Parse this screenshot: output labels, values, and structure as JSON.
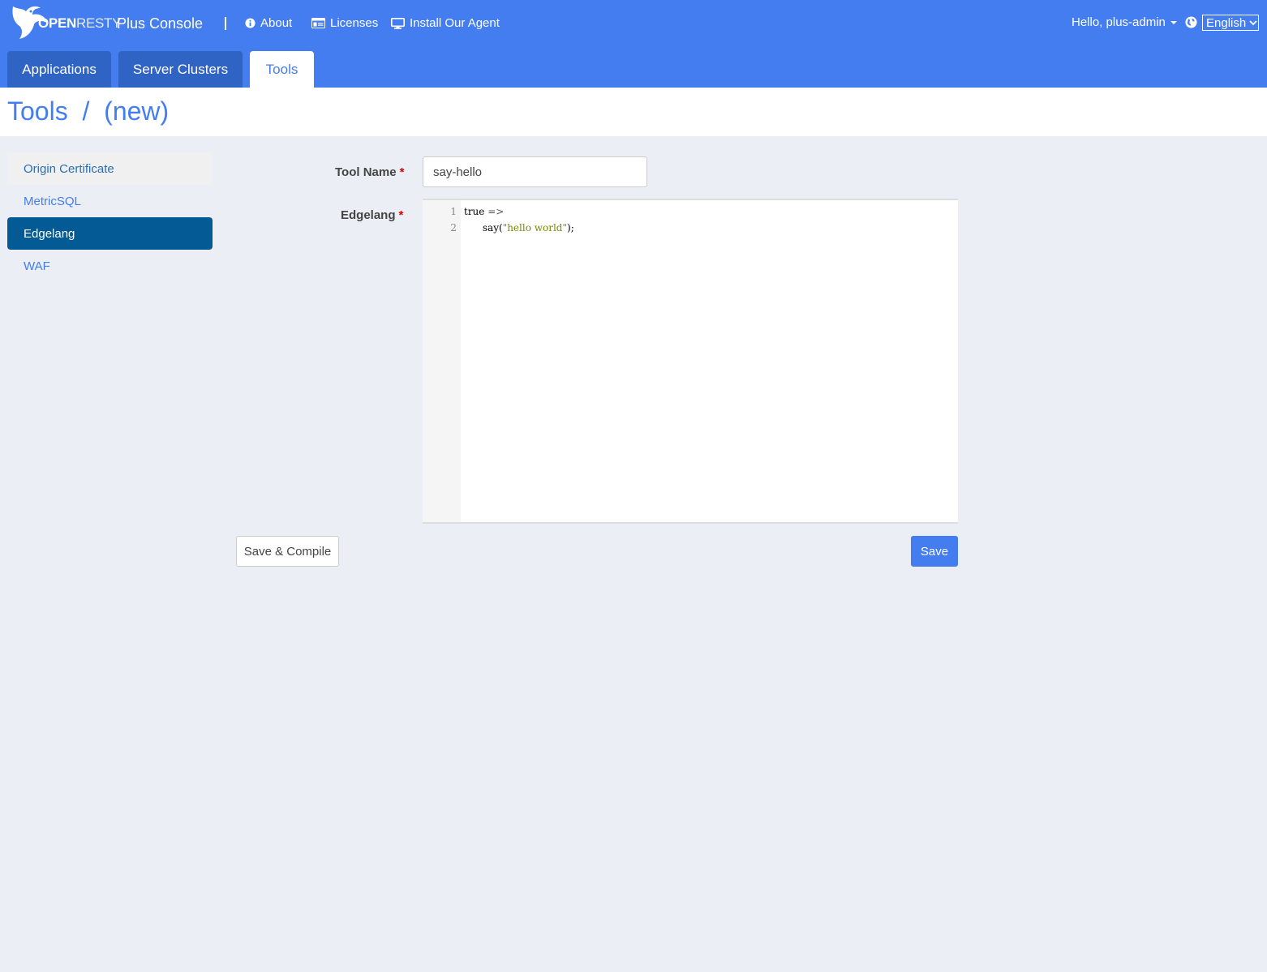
{
  "header": {
    "logo_open": "OPEN",
    "logo_resty": "RESTY",
    "app_title": "Plus Console",
    "nav": [
      {
        "label": "About",
        "icon": "info-circle-icon"
      },
      {
        "label": "Licenses",
        "icon": "id-card-icon"
      },
      {
        "label": "Install Our Agent",
        "icon": "desktop-icon"
      }
    ],
    "user_greeting": "Hello, plus-admin",
    "language": "English",
    "accent_color": "#437def"
  },
  "tabs": [
    {
      "label": "Applications",
      "active": false
    },
    {
      "label": "Server Clusters",
      "active": false
    },
    {
      "label": "Tools",
      "active": true
    }
  ],
  "page": {
    "title": "Tools  /  (new)"
  },
  "sidebar": {
    "items": [
      {
        "label": "Origin Certificate"
      },
      {
        "label": "MetricSQL"
      },
      {
        "label": "Edgelang",
        "active": true
      },
      {
        "label": "WAF"
      }
    ]
  },
  "form": {
    "tool_name_label": "Tool Name",
    "tool_name_value": "say-hello",
    "edgelang_label": "Edgelang",
    "required_mark": "*",
    "code_lines": [
      {
        "no": "1",
        "kw": "true",
        "op": " =>",
        "str": "",
        "tail": ""
      },
      {
        "no": "2",
        "kw": "      say(",
        "op": "",
        "str": "\"hello world\"",
        "tail": ");"
      }
    ]
  },
  "buttons": {
    "save_compile": "Save & Compile",
    "save": "Save"
  }
}
